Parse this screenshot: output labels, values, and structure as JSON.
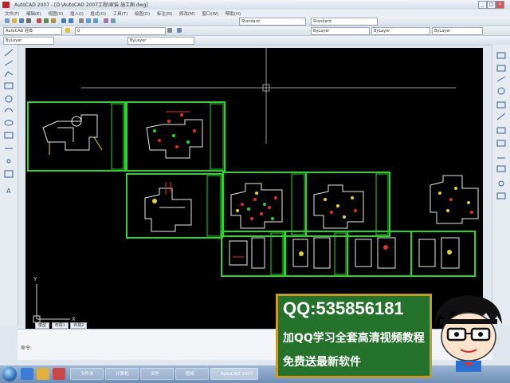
{
  "window": {
    "title": "AutoCAD 2007 - [D:\\AutoCAD 2007工程\\家装 施工图.dwg]",
    "min": "_",
    "max": "□",
    "close": "×"
  },
  "menu": [
    "文件(F)",
    "编辑(E)",
    "视图(V)",
    "插入(I)",
    "格式(O)",
    "工具(T)",
    "绘图(D)",
    "标注(N)",
    "修改(M)",
    "窗口(W)",
    "帮助(H)"
  ],
  "toolbar": {
    "workspace": "AutoCAD 经典",
    "layer": "0",
    "style": "Standard",
    "bylayer": "ByLayer"
  },
  "ucs": {
    "y": "Y",
    "x": "X"
  },
  "layout_tabs": [
    "模型",
    "布局1",
    "布局2"
  ],
  "command": {
    "prompt": "命令:"
  },
  "taskbar": {
    "tasks": [
      "文件夹",
      "计算机",
      "文件",
      "图纸",
      "AutoCAD 2007"
    ]
  },
  "overlay": {
    "qq": "QQ:535856181",
    "line1": "加QQ学习全套高清视频教程",
    "line2": "免费送最新软件"
  },
  "colors": {
    "frame": "#2bd42b",
    "ad_bg": "#24722b",
    "ad_border": "#c39a35",
    "canvas": "#000000"
  }
}
